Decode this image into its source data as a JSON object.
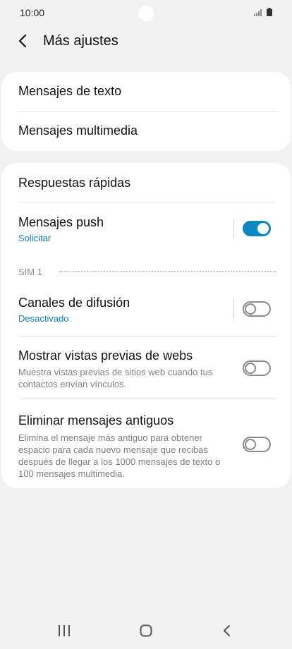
{
  "status_bar": {
    "time": "10:00"
  },
  "header": {
    "title": "Más ajustes"
  },
  "card1": {
    "items": [
      {
        "label": "Mensajes de texto"
      },
      {
        "label": "Mensajes multimedia"
      }
    ]
  },
  "card2": {
    "quick_replies": {
      "label": "Respuestas rápidas"
    },
    "push": {
      "label": "Mensajes push",
      "sub": "Solicitar",
      "toggle": "on"
    },
    "sim_header": "SIM 1",
    "broadcast": {
      "label": "Canales de difusión",
      "sub": "Desactivado",
      "toggle": "off"
    },
    "web_preview": {
      "label": "Mostrar vistas previas de webs",
      "desc": "Muestra vistas previas de sitios web cuando tus contactos envían vínculos.",
      "toggle": "off"
    },
    "delete_old": {
      "label": "Eliminar mensajes antiguos",
      "desc": "Elimina el mensaje más antiguo para obtener espacio para cada nuevo mensaje que recibas después de llegar a los 1000 mensajes de texto o 100 mensajes multimedia.",
      "toggle": "off"
    }
  },
  "icons": {
    "back": "chevron-left-icon",
    "signal": "signal-icon",
    "battery": "battery-icon",
    "nav_recents": "recents-icon",
    "nav_home": "home-icon",
    "nav_back": "back-icon"
  },
  "colors": {
    "accent": "#0e86c4",
    "background": "#f2f2f2",
    "card": "#ffffff"
  }
}
